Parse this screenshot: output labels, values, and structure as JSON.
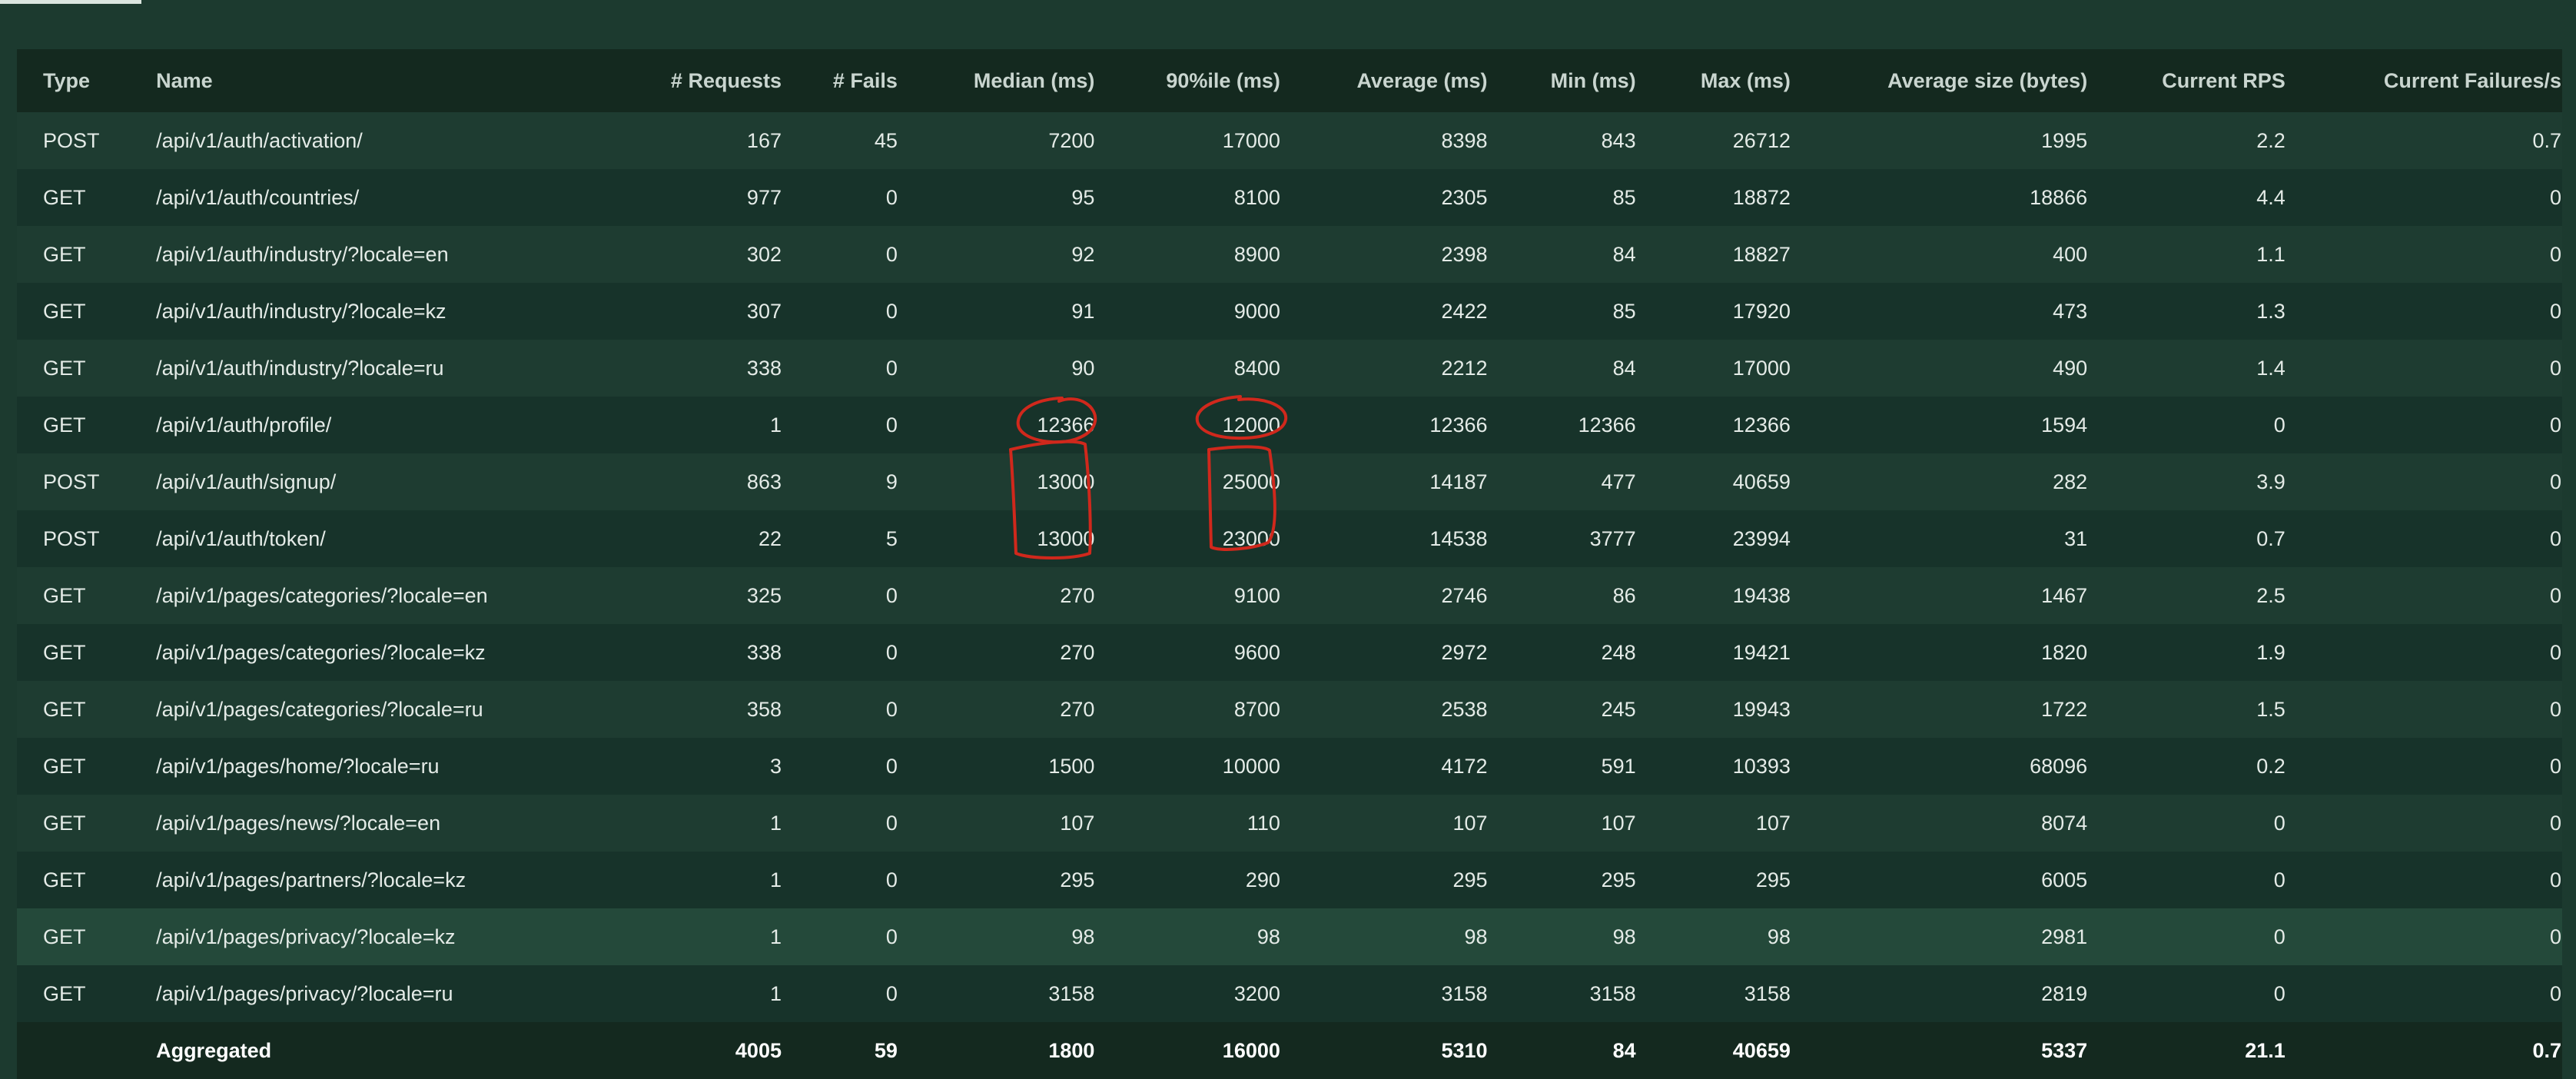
{
  "columns": {
    "type": "Type",
    "name": "Name",
    "requests": "# Requests",
    "fails": "# Fails",
    "median": "Median (ms)",
    "p90": "90%ile (ms)",
    "average": "Average (ms)",
    "min": "Min (ms)",
    "max": "Max (ms)",
    "avg_size": "Average size (bytes)",
    "rps": "Current RPS",
    "failures_s": "Current Failures/s"
  },
  "rows": [
    {
      "type": "POST",
      "name": "/api/v1/auth/activation/",
      "requests": "167",
      "fails": "45",
      "median": "7200",
      "p90": "17000",
      "average": "8398",
      "min": "843",
      "max": "26712",
      "avg_size": "1995",
      "rps": "2.2",
      "failures_s": "0.7"
    },
    {
      "type": "GET",
      "name": "/api/v1/auth/countries/",
      "requests": "977",
      "fails": "0",
      "median": "95",
      "p90": "8100",
      "average": "2305",
      "min": "85",
      "max": "18872",
      "avg_size": "18866",
      "rps": "4.4",
      "failures_s": "0"
    },
    {
      "type": "GET",
      "name": "/api/v1/auth/industry/?locale=en",
      "requests": "302",
      "fails": "0",
      "median": "92",
      "p90": "8900",
      "average": "2398",
      "min": "84",
      "max": "18827",
      "avg_size": "400",
      "rps": "1.1",
      "failures_s": "0"
    },
    {
      "type": "GET",
      "name": "/api/v1/auth/industry/?locale=kz",
      "requests": "307",
      "fails": "0",
      "median": "91",
      "p90": "9000",
      "average": "2422",
      "min": "85",
      "max": "17920",
      "avg_size": "473",
      "rps": "1.3",
      "failures_s": "0"
    },
    {
      "type": "GET",
      "name": "/api/v1/auth/industry/?locale=ru",
      "requests": "338",
      "fails": "0",
      "median": "90",
      "p90": "8400",
      "average": "2212",
      "min": "84",
      "max": "17000",
      "avg_size": "490",
      "rps": "1.4",
      "failures_s": "0"
    },
    {
      "type": "GET",
      "name": "/api/v1/auth/profile/",
      "requests": "1",
      "fails": "0",
      "median": "12366",
      "p90": "12000",
      "average": "12366",
      "min": "12366",
      "max": "12366",
      "avg_size": "1594",
      "rps": "0",
      "failures_s": "0"
    },
    {
      "type": "POST",
      "name": "/api/v1/auth/signup/",
      "requests": "863",
      "fails": "9",
      "median": "13000",
      "p90": "25000",
      "average": "14187",
      "min": "477",
      "max": "40659",
      "avg_size": "282",
      "rps": "3.9",
      "failures_s": "0"
    },
    {
      "type": "POST",
      "name": "/api/v1/auth/token/",
      "requests": "22",
      "fails": "5",
      "median": "13000",
      "p90": "23000",
      "average": "14538",
      "min": "3777",
      "max": "23994",
      "avg_size": "31",
      "rps": "0.7",
      "failures_s": "0"
    },
    {
      "type": "GET",
      "name": "/api/v1/pages/categories/?locale=en",
      "requests": "325",
      "fails": "0",
      "median": "270",
      "p90": "9100",
      "average": "2746",
      "min": "86",
      "max": "19438",
      "avg_size": "1467",
      "rps": "2.5",
      "failures_s": "0"
    },
    {
      "type": "GET",
      "name": "/api/v1/pages/categories/?locale=kz",
      "requests": "338",
      "fails": "0",
      "median": "270",
      "p90": "9600",
      "average": "2972",
      "min": "248",
      "max": "19421",
      "avg_size": "1820",
      "rps": "1.9",
      "failures_s": "0"
    },
    {
      "type": "GET",
      "name": "/api/v1/pages/categories/?locale=ru",
      "requests": "358",
      "fails": "0",
      "median": "270",
      "p90": "8700",
      "average": "2538",
      "min": "245",
      "max": "19943",
      "avg_size": "1722",
      "rps": "1.5",
      "failures_s": "0"
    },
    {
      "type": "GET",
      "name": "/api/v1/pages/home/?locale=ru",
      "requests": "3",
      "fails": "0",
      "median": "1500",
      "p90": "10000",
      "average": "4172",
      "min": "591",
      "max": "10393",
      "avg_size": "68096",
      "rps": "0.2",
      "failures_s": "0"
    },
    {
      "type": "GET",
      "name": "/api/v1/pages/news/?locale=en",
      "requests": "1",
      "fails": "0",
      "median": "107",
      "p90": "110",
      "average": "107",
      "min": "107",
      "max": "107",
      "avg_size": "8074",
      "rps": "0",
      "failures_s": "0"
    },
    {
      "type": "GET",
      "name": "/api/v1/pages/partners/?locale=kz",
      "requests": "1",
      "fails": "0",
      "median": "295",
      "p90": "290",
      "average": "295",
      "min": "295",
      "max": "295",
      "avg_size": "6005",
      "rps": "0",
      "failures_s": "0"
    },
    {
      "type": "GET",
      "name": "/api/v1/pages/privacy/?locale=kz",
      "requests": "1",
      "fails": "0",
      "median": "98",
      "p90": "98",
      "average": "98",
      "min": "98",
      "max": "98",
      "avg_size": "2981",
      "rps": "0",
      "failures_s": "0"
    },
    {
      "type": "GET",
      "name": "/api/v1/pages/privacy/?locale=ru",
      "requests": "1",
      "fails": "0",
      "median": "3158",
      "p90": "3200",
      "average": "3158",
      "min": "3158",
      "max": "3158",
      "avg_size": "2819",
      "rps": "0",
      "failures_s": "0"
    }
  ],
  "aggregated": {
    "type": "",
    "name": "Aggregated",
    "requests": "4005",
    "fails": "59",
    "median": "1800",
    "p90": "16000",
    "average": "5310",
    "min": "84",
    "max": "40659",
    "avg_size": "5337",
    "rps": "21.1",
    "failures_s": "0.7"
  },
  "highlighted_row": 14,
  "colors": {
    "background": "#1c3a2f",
    "header": "#14291f",
    "row_odd": "#1e3c31",
    "row_even": "#17332a",
    "row_hover": "#24493a",
    "annotation": "#d0281c"
  }
}
